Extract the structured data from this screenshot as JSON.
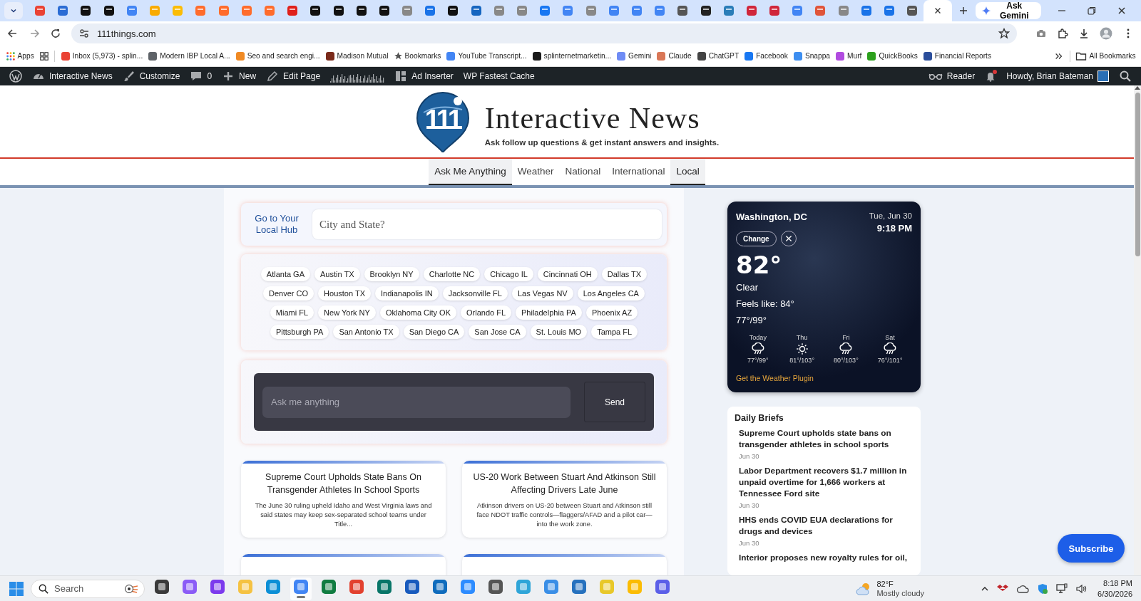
{
  "browser": {
    "tabs": [
      {
        "color": "#ea4335",
        "selected": false
      },
      {
        "color": "#2b6cd4",
        "selected": false
      },
      {
        "color": "#111111",
        "selected": false
      },
      {
        "color": "#111111",
        "selected": false
      },
      {
        "color": "#4285f4",
        "selected": false
      },
      {
        "color": "#f9ab00",
        "selected": false
      },
      {
        "color": "#fbbc04",
        "selected": false
      },
      {
        "color": "#ff6c2c",
        "selected": false
      },
      {
        "color": "#ff6c2c",
        "selected": false
      },
      {
        "color": "#ff6c2c",
        "selected": false
      },
      {
        "color": "#ff6c2c",
        "selected": false
      },
      {
        "color": "#e0201b",
        "selected": false
      },
      {
        "color": "#111111",
        "selected": false
      },
      {
        "color": "#111111",
        "selected": false
      },
      {
        "color": "#111111",
        "selected": false
      },
      {
        "color": "#111111",
        "selected": false
      },
      {
        "color": "#888888",
        "selected": false
      },
      {
        "color": "#1a73e8",
        "selected": false
      },
      {
        "color": "#111111",
        "selected": false
      },
      {
        "color": "#1565c0",
        "selected": false
      },
      {
        "color": "#888888",
        "selected": false
      },
      {
        "color": "#888888",
        "selected": false
      },
      {
        "color": "#1877f2",
        "selected": false
      },
      {
        "color": "#4285f4",
        "selected": false
      },
      {
        "color": "#888888",
        "selected": false
      },
      {
        "color": "#4285f4",
        "selected": false
      },
      {
        "color": "#4285f4",
        "selected": false
      },
      {
        "color": "#4285f4",
        "selected": false
      },
      {
        "color": "#555555",
        "selected": false
      },
      {
        "color": "#222222",
        "selected": false
      },
      {
        "color": "#2a7db8",
        "selected": false
      },
      {
        "color": "#d0263b",
        "selected": false
      },
      {
        "color": "#d0263b",
        "selected": false
      },
      {
        "color": "#4285f4",
        "selected": false
      },
      {
        "color": "#e0553b",
        "selected": false
      },
      {
        "color": "#888888",
        "selected": false
      },
      {
        "color": "#1a73e8",
        "selected": false
      },
      {
        "color": "#1a73e8",
        "selected": false
      },
      {
        "color": "#555555",
        "selected": false
      },
      {
        "selected": true
      }
    ],
    "gemini_button": "Ask Gemini",
    "url": "111things.com",
    "bookmarks": [
      {
        "kind": "apps",
        "label": "Apps"
      },
      {
        "kind": "grid"
      },
      {
        "kind": "favicon",
        "color": "#ea4335",
        "label": "Inbox (5,973) - splin..."
      },
      {
        "kind": "favicon",
        "color": "#5f6368",
        "label": "Modern IBP Local A..."
      },
      {
        "kind": "favicon",
        "color": "#f08a24",
        "label": "Seo and search engi..."
      },
      {
        "kind": "favicon",
        "color": "#7a2a1a",
        "label": "Madison Mutual"
      },
      {
        "kind": "star",
        "label": "Bookmarks"
      },
      {
        "kind": "favicon",
        "color": "#4285f4",
        "label": "YouTube Transcript..."
      },
      {
        "kind": "favicon",
        "color": "#1a1a1a",
        "label": "splinternetmarketin..."
      },
      {
        "kind": "favicon",
        "color": "#6f8cf5",
        "label": "Gemini"
      },
      {
        "kind": "favicon",
        "color": "#d97757",
        "label": "Claude"
      },
      {
        "kind": "favicon",
        "color": "#444444",
        "label": "ChatGPT"
      },
      {
        "kind": "favicon",
        "color": "#1877f2",
        "label": "Facebook"
      },
      {
        "kind": "favicon",
        "color": "#3d8ef0",
        "label": "Snappa"
      },
      {
        "kind": "favicon",
        "color": "#b14be0",
        "label": "Murf"
      },
      {
        "kind": "favicon",
        "color": "#2ca01c",
        "label": "QuickBooks"
      },
      {
        "kind": "favicon",
        "color": "#2b4e9b",
        "label": "Financial Reports"
      }
    ],
    "all_bookmarks": "All Bookmarks"
  },
  "admin_bar": {
    "left": [
      {
        "kind": "wordpress"
      },
      {
        "kind": "dashboard",
        "label": "Interactive News"
      },
      {
        "kind": "customize",
        "label": "Customize"
      },
      {
        "kind": "comments",
        "label": "0"
      },
      {
        "kind": "new",
        "label": "New"
      },
      {
        "kind": "edit",
        "label": "Edit Page"
      },
      {
        "kind": "stats"
      },
      {
        "kind": "ad",
        "label": "Ad Inserter"
      },
      {
        "kind": "plain",
        "label": "WP Fastest Cache"
      }
    ],
    "right": [
      {
        "kind": "reader",
        "label": "Reader"
      },
      {
        "kind": "notifications",
        "unread": true
      },
      {
        "kind": "account",
        "label": "Howdy, Brian Bateman"
      },
      {
        "kind": "search"
      }
    ]
  },
  "site": {
    "logo_text": "111",
    "title": "Interactive News",
    "tagline": "Ask follow up questions & get instant answers and insights.",
    "nav": [
      {
        "label": "Ask Me Anything",
        "selected": true
      },
      {
        "label": "Weather",
        "selected": false
      },
      {
        "label": "National",
        "selected": false
      },
      {
        "label": "International",
        "selected": false
      },
      {
        "label": "Local",
        "selected": true
      }
    ]
  },
  "local_hub": {
    "label": "Go to Your Local Hub",
    "placeholder": "City and State?"
  },
  "cities": [
    "Atlanta GA",
    "Austin TX",
    "Brooklyn NY",
    "Charlotte NC",
    "Chicago IL",
    "Cincinnati OH",
    "Dallas TX",
    "Denver CO",
    "Houston TX",
    "Indianapolis IN",
    "Jacksonville FL",
    "Las Vegas NV",
    "Los Angeles CA",
    "Miami FL",
    "New York NY",
    "Oklahoma City OK",
    "Orlando FL",
    "Philadelphia PA",
    "Phoenix AZ",
    "Pittsburgh PA",
    "San Antonio TX",
    "San Diego CA",
    "San Jose CA",
    "St. Louis MO",
    "Tampa FL"
  ],
  "ask": {
    "placeholder": "Ask me anything",
    "button": "Send"
  },
  "cards": [
    {
      "title": "Supreme Court Upholds State Bans On Transgender Athletes In School Sports",
      "summary": "The June 30 ruling upheld Idaho and West Virginia laws and said states may keep sex-separated school teams under Title..."
    },
    {
      "title": "US-20 Work Between Stuart And Atkinson Still Affecting Drivers Late June",
      "summary": "Atkinson drivers on US-20 between Stuart and Atkinson still face NDOT traffic controls—flaggers/AFAD and a pilot car—into the work zone."
    }
  ],
  "weather": {
    "city": "Washington, DC",
    "date": "Tue, Jun 30",
    "time": "9:18 PM",
    "change_button": "Change",
    "temperature": "82°",
    "condition": "Clear",
    "feels_like": "Feels like: 84°",
    "range": "77°/99°",
    "forecast": [
      {
        "day": "Today",
        "kind": "rain",
        "range": "77°/99°"
      },
      {
        "day": "Thu",
        "kind": "sun",
        "range": "81°/103°"
      },
      {
        "day": "Fri",
        "kind": "rain",
        "range": "80°/103°"
      },
      {
        "day": "Sat",
        "kind": "rain",
        "range": "76°/101°"
      }
    ],
    "plugin_link": "Get the Weather Plugin"
  },
  "daily_briefs": {
    "title": "Daily Briefs",
    "items": [
      {
        "headline": "Supreme Court upholds state bans on transgender athletes in school sports",
        "date": "Jun 30"
      },
      {
        "headline": "Labor Department recovers $1.7 million in unpaid overtime for 1,666 workers at Tennessee Ford site",
        "date": "Jun 30"
      },
      {
        "headline": "HHS ends COVID EUA declarations for drugs and devices",
        "date": "Jun 30"
      },
      {
        "headline": "Interior proposes new royalty rules for oil,"
      }
    ]
  },
  "subscribe_button": "Subscribe",
  "taskbar": {
    "search_placeholder": "Search",
    "apps": [
      {
        "color": "#3a3a3a",
        "selected": false
      },
      {
        "color": "#8b5cf6",
        "selected": false
      },
      {
        "color": "#7c3aed",
        "selected": false
      },
      {
        "color": "#f5c242",
        "selected": false
      },
      {
        "color": "#0c8fd6",
        "selected": false
      },
      {
        "color": "#4285f4",
        "selected": true
      },
      {
        "color": "#107c41",
        "selected": false
      },
      {
        "color": "#e2412f",
        "selected": false
      },
      {
        "color": "#077568",
        "selected": false
      },
      {
        "color": "#185abd",
        "selected": false
      },
      {
        "color": "#0f6cbd",
        "selected": false
      },
      {
        "color": "#2d8cff",
        "selected": false
      },
      {
        "color": "#555555",
        "selected": false
      },
      {
        "color": "#2fa5d8",
        "selected": false
      },
      {
        "color": "#3a8ee6",
        "selected": false
      },
      {
        "color": "#2671be",
        "selected": false
      },
      {
        "color": "#e8c82a",
        "selected": false
      },
      {
        "color": "#fbbc04",
        "selected": false
      },
      {
        "color": "#5b5fe8",
        "selected": false
      }
    ],
    "weather_temp": "82°F",
    "weather_text": "Mostly cloudy",
    "time": "8:18 PM",
    "date": "6/30/2026"
  }
}
